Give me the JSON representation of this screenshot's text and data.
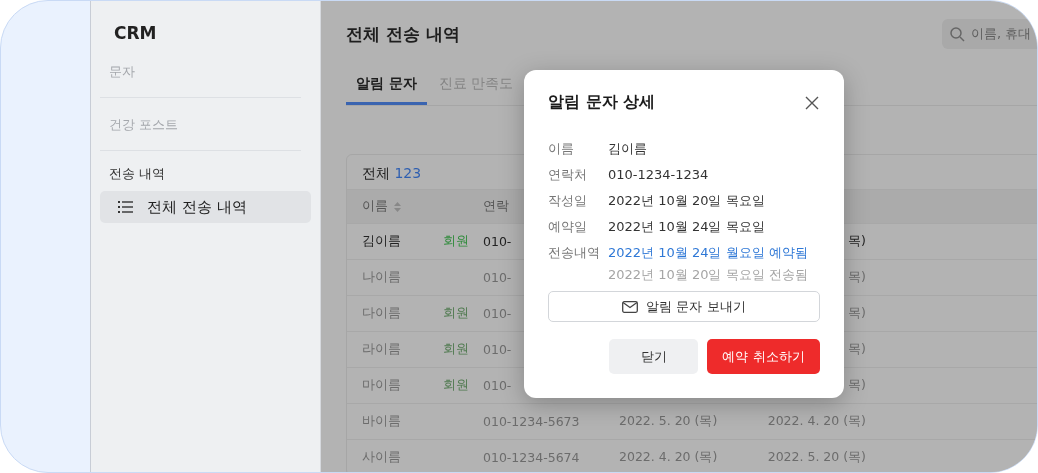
{
  "sidebar": {
    "title": "CRM",
    "items": [
      {
        "label": "문자",
        "kind": "link",
        "selected": false
      },
      {
        "label": "건강 포스트",
        "kind": "link",
        "selected": false
      },
      {
        "label": "전송 내역",
        "kind": "heading"
      },
      {
        "label": "전체 전송 내역",
        "kind": "nav",
        "selected": true
      }
    ]
  },
  "page": {
    "title": "전체 전송 내역",
    "search": {
      "placeholder": "이름, 휴대"
    }
  },
  "tabs": [
    {
      "label": "알림 문자",
      "selected": true
    },
    {
      "label": "진료 만족도",
      "selected": false
    }
  ],
  "table": {
    "total_label": "전체",
    "total_count": "123",
    "columns": [
      "이름",
      "연락"
    ],
    "rows": [
      {
        "name": "김이름",
        "tag": "회원",
        "phone": "010-",
        "date_2": "목)",
        "active": true
      },
      {
        "name": "나이름",
        "phone": "010-",
        "date_2": "목)",
        "active": false
      },
      {
        "name": "다이름",
        "tag": "회원",
        "phone": "010-",
        "date_2": "목)",
        "active": false
      },
      {
        "name": "라이름",
        "tag": "회원",
        "phone": "010-",
        "date_2": "목)",
        "active": false
      },
      {
        "name": "마이름",
        "tag": "회원",
        "phone": "010-",
        "date_2": "목)",
        "active": false
      },
      {
        "name": "바이름",
        "phone": "010-1234-5673",
        "date_1": "2022. 5. 20 (목)",
        "date_2": "2022. 4. 20 (목)",
        "active": false
      },
      {
        "name": "사이름",
        "phone": "010-1234-5674",
        "date_1": "2022. 4. 20 (목)",
        "date_2": "2022. 5. 20 (목)",
        "active": false
      }
    ]
  },
  "modal": {
    "title": "알림 문자 상세",
    "fields": [
      {
        "label": "이름",
        "values": [
          {
            "text": "김이름",
            "kind": "normal"
          }
        ]
      },
      {
        "label": "연락처",
        "values": [
          {
            "text": "010-1234-1234",
            "kind": "normal"
          }
        ]
      },
      {
        "label": "작성일",
        "values": [
          {
            "text": "2022년 10월 20일 목요일",
            "kind": "normal"
          }
        ]
      },
      {
        "label": "예약일",
        "values": [
          {
            "text": "2022년 10월 24일 목요일",
            "kind": "normal"
          }
        ]
      },
      {
        "label": "전송내역",
        "values": [
          {
            "text": "2022년 10월 24일 월요일 예약됨",
            "kind": "link"
          },
          {
            "text": "2022년 10월 20일 목요일 전송됨",
            "kind": "muted"
          }
        ]
      }
    ],
    "send_button": "알림 문자 보내기",
    "close_button": "닫기",
    "cancel_button": "예약 취소하기"
  }
}
